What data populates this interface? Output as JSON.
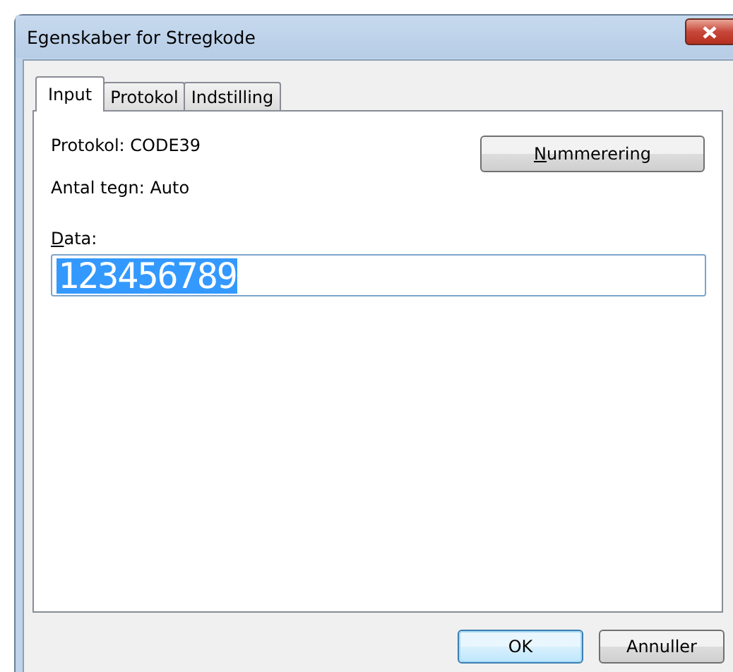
{
  "window": {
    "title": "Egenskaber for Stregkode"
  },
  "tabs": [
    {
      "label": "Input",
      "selected": true
    },
    {
      "label": "Protokol",
      "selected": false
    },
    {
      "label": "Indstilling",
      "selected": false
    }
  ],
  "info": [
    {
      "text": "Protokol: CODE39"
    },
    {
      "text": "Antal tegn: Auto"
    }
  ],
  "numbering_button": {
    "label": "Nummerering"
  },
  "data_field": {
    "label": "Data:",
    "value": "123456789",
    "selected": true
  },
  "buttons": [
    {
      "label": "OK",
      "default": true
    },
    {
      "label": "Annuller",
      "default": false
    }
  ]
}
